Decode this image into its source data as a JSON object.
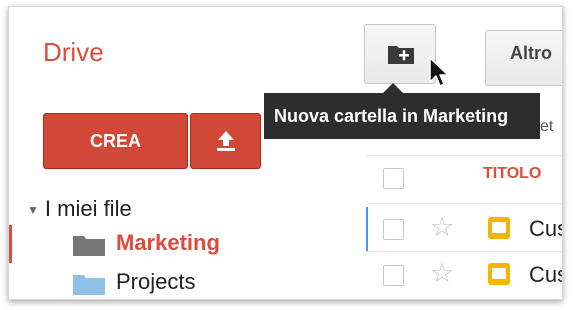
{
  "app": {
    "title": "Drive"
  },
  "toolbar": {
    "more_label": "Altro",
    "tooltip": "Nuova cartella in Marketing"
  },
  "header_peek": "et",
  "sidebar": {
    "create_label": "CREA",
    "root": "I miei file",
    "items": [
      {
        "label": "Marketing",
        "selected": true,
        "icon": "folder-dark-icon"
      },
      {
        "label": "Projects",
        "selected": false,
        "icon": "folder-blue-icon"
      }
    ]
  },
  "list": {
    "column_title": "TITOLO",
    "rows": [
      {
        "name": "Cus",
        "icon": "slides-icon",
        "starred": false
      },
      {
        "name": "Cus",
        "icon": "slides-icon",
        "starred": false
      }
    ]
  },
  "colors": {
    "accent": "#dd4b39",
    "button": "#d14836",
    "tooltip_bg": "#2d2d2d",
    "folder_selected": "#777777",
    "folder_blue": "#8fc1e8",
    "slides": "#f4b400",
    "focus": "#4d90fe"
  }
}
